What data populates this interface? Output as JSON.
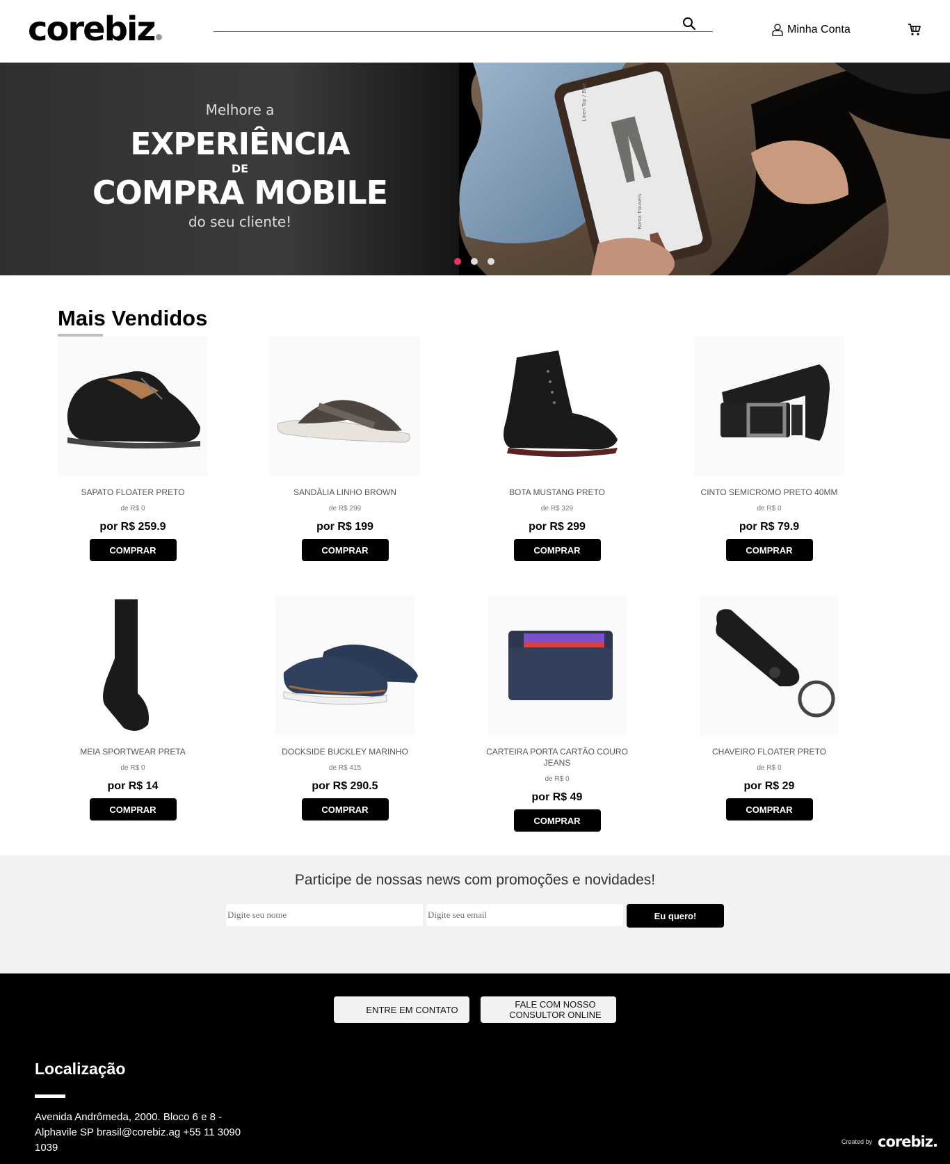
{
  "header": {
    "logo": "corebiz",
    "search": {
      "value": "",
      "placeholder": ""
    },
    "account_label": "Minha Conta"
  },
  "banner": {
    "line1": "Melhore a",
    "line2": "EXPERIÊNCIA",
    "line3": "DE",
    "line4": "COMPRA MOBILE",
    "line5": "do seu cliente!",
    "phone_labels": [
      "Linen Top / Blue",
      "Roma Trousers"
    ],
    "slides": 3,
    "active_slide": 1,
    "accent_color": "#e8385a"
  },
  "best_sellers": {
    "title": "Mais Vendidos",
    "products": [
      {
        "name": "SAPATO FLOATER PRETO",
        "old_price": "de R$ 0",
        "price": "por R$ 259.9",
        "buy": "COMPRAR",
        "icon": "shoe-icon"
      },
      {
        "name": "SANDÁLIA LINHO BROWN",
        "old_price": "de R$ 299",
        "price": "por R$ 199",
        "buy": "COMPRAR",
        "icon": "sandal-icon"
      },
      {
        "name": "BOTA MUSTANG PRETO",
        "old_price": "de R$ 329",
        "price": "por R$ 299",
        "buy": "COMPRAR",
        "icon": "boot-icon"
      },
      {
        "name": "CINTO SEMICROMO PRETO 40MM",
        "old_price": "de R$ 0",
        "price": "por R$ 79.9",
        "buy": "COMPRAR",
        "icon": "belt-icon"
      },
      {
        "name": "MEIA SPORTWEAR PRETA",
        "old_price": "de R$ 0",
        "price": "por R$ 14",
        "buy": "COMPRAR",
        "icon": "sock-icon"
      },
      {
        "name": "DOCKSIDE BUCKLEY MARINHO",
        "old_price": "de R$ 415",
        "price": "por R$ 290.5",
        "buy": "COMPRAR",
        "icon": "boat-shoe-icon"
      },
      {
        "name": "CARTEIRA PORTA CARTÃO COURO JEANS",
        "old_price": "de R$ 0",
        "price": "por R$ 49",
        "buy": "COMPRAR",
        "icon": "wallet-icon"
      },
      {
        "name": "CHAVEIRO FLOATER PRETO",
        "old_price": "de R$ 0",
        "price": "por R$ 29",
        "buy": "COMPRAR",
        "icon": "keychain-icon"
      }
    ]
  },
  "newsletter": {
    "title": "Participe de nossas news com promoções e novidades!",
    "name_placeholder": "Digite seu nome",
    "email_placeholder": "Digite seu email",
    "submit": "Eu quero!"
  },
  "footer": {
    "contact_button": "ENTRE EM CONTATO",
    "consultant_button_line1": "FALE COM NOSSO",
    "consultant_button_line2": "CONSULTOR ONLINE",
    "location_title": "Localização",
    "address": "Avenida Andrômeda, 2000. Bloco 6 e 8 - Alphavile SP brasil@corebiz.ag +55 11 3090 1039",
    "credit_label": "Created by",
    "credit_logo": "corebiz."
  }
}
